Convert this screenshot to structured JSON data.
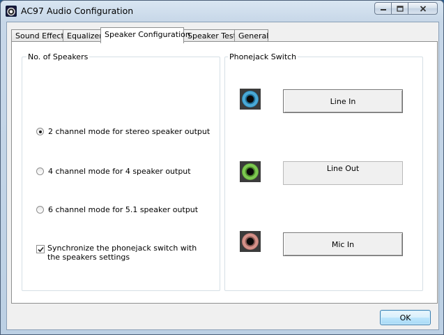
{
  "window": {
    "title": "AC97 Audio Configuration"
  },
  "tabs": [
    {
      "label": "Sound Effect",
      "active": false
    },
    {
      "label": "Equalizer",
      "active": false
    },
    {
      "label": "Speaker Configuration",
      "active": true
    },
    {
      "label": "Speaker Test",
      "active": false
    },
    {
      "label": "General",
      "active": false
    }
  ],
  "speakers_group": {
    "title": "No. of Speakers",
    "options": [
      {
        "label": "2 channel mode for stereo speaker output",
        "checked": true
      },
      {
        "label": "4 channel mode for 4 speaker output",
        "checked": false
      },
      {
        "label": "6 channel mode for 5.1 speaker output",
        "checked": false
      }
    ],
    "sync_checkbox": {
      "label": "Synchronize the phonejack switch with the speakers settings",
      "checked": true
    }
  },
  "phonejack_group": {
    "title": "Phonejack Switch",
    "jacks": [
      {
        "icon": "blue-jack-icon",
        "color": "#4aa9d6",
        "button": "Line In",
        "style": "raised"
      },
      {
        "icon": "green-jack-icon",
        "color": "#7cc850",
        "button": "Line Out",
        "style": "flat"
      },
      {
        "icon": "pink-jack-icon",
        "color": "#d49088",
        "button": "Mic In",
        "style": "raised"
      }
    ]
  },
  "footer": {
    "ok_label": "OK"
  }
}
